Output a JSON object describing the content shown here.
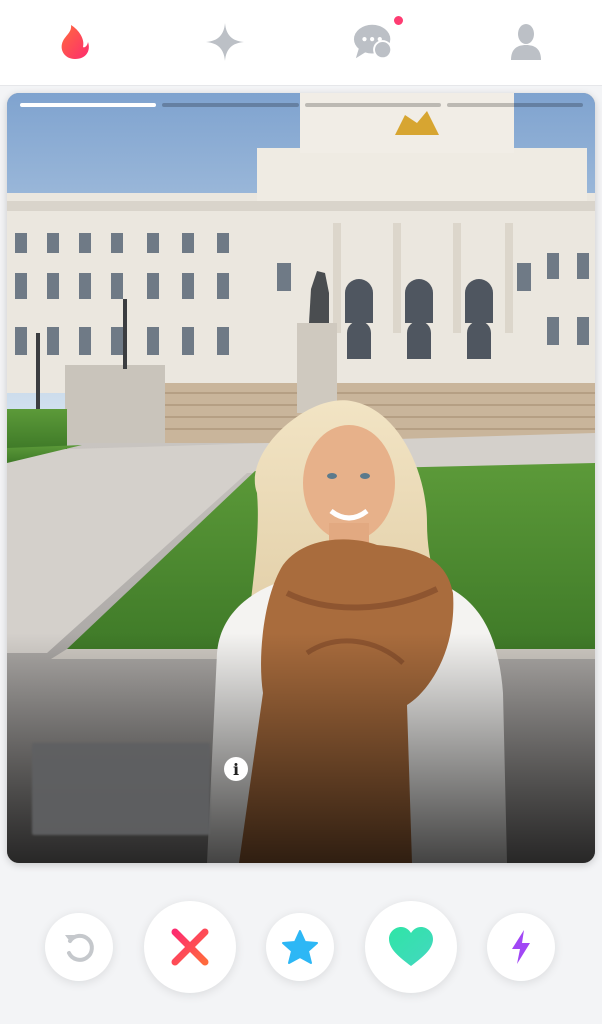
{
  "nav": {
    "items": [
      {
        "icon": "flame-icon",
        "color": "#fd5068",
        "active": true
      },
      {
        "icon": "sparkle-icon",
        "color": "#bcc0c6",
        "active": false
      },
      {
        "icon": "messages-icon",
        "color": "#bcc0c6",
        "active": false,
        "badge_color": "#fe3c72"
      },
      {
        "icon": "profile-icon",
        "color": "#bcc0c6",
        "active": false
      }
    ]
  },
  "card": {
    "photo_count": 4,
    "active_photo_index": 0,
    "name_redacted": true,
    "info_label": "i"
  },
  "actions": [
    {
      "name": "rewind",
      "icon": "rewind-icon",
      "color": "#c5c8cc"
    },
    {
      "name": "nope",
      "icon": "close-icon",
      "color": "#fd4a5c"
    },
    {
      "name": "super-like",
      "icon": "star-icon",
      "color": "#2db7f5"
    },
    {
      "name": "like",
      "icon": "heart-icon",
      "color": "#35e2a7"
    },
    {
      "name": "boost",
      "icon": "lightning-icon",
      "color": "#a147f5"
    }
  ]
}
